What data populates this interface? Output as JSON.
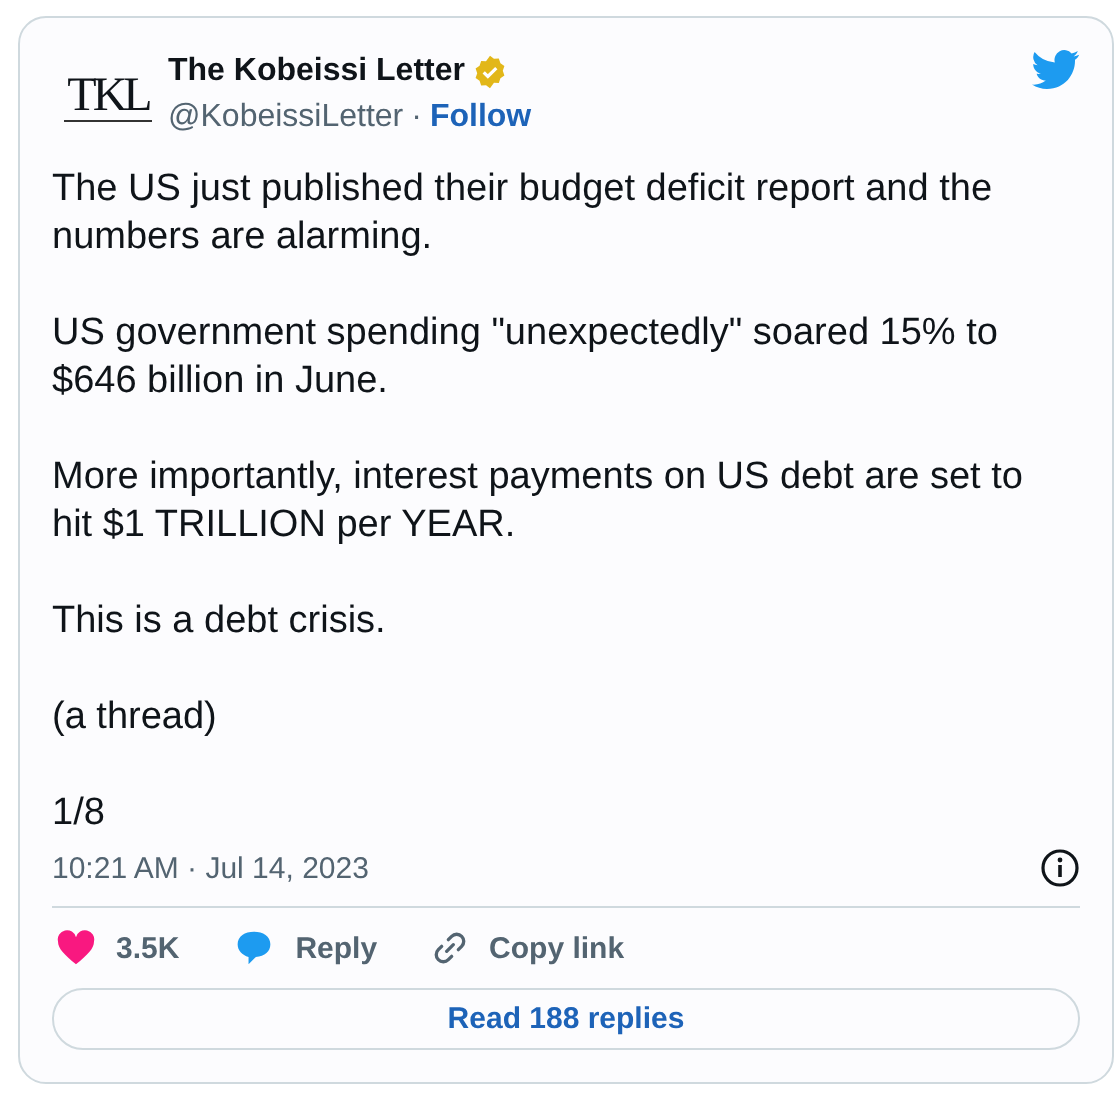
{
  "author": {
    "logo_text": "TKL",
    "name": "The Kobeissi Letter",
    "verified": true,
    "handle": "@KobeissiLetter",
    "separator": "·",
    "follow": "Follow"
  },
  "paragraphs": [
    "The US just published their budget deficit report and the numbers are alarming.",
    "US government spending \"unexpectedly\" soared 15% to $646 billion in June.",
    "More importantly, interest payments on US debt are set to hit $1 TRILLION per YEAR.",
    "This is a debt crisis.",
    "(a thread)",
    "1/8"
  ],
  "timestamp": "10:21 AM · Jul 14, 2023",
  "actions": [
    {
      "kind": "like",
      "label": "3.5K"
    },
    {
      "kind": "reply",
      "label": "Reply"
    },
    {
      "kind": "copy",
      "label": "Copy link"
    }
  ],
  "read_button": "Read 188 replies"
}
